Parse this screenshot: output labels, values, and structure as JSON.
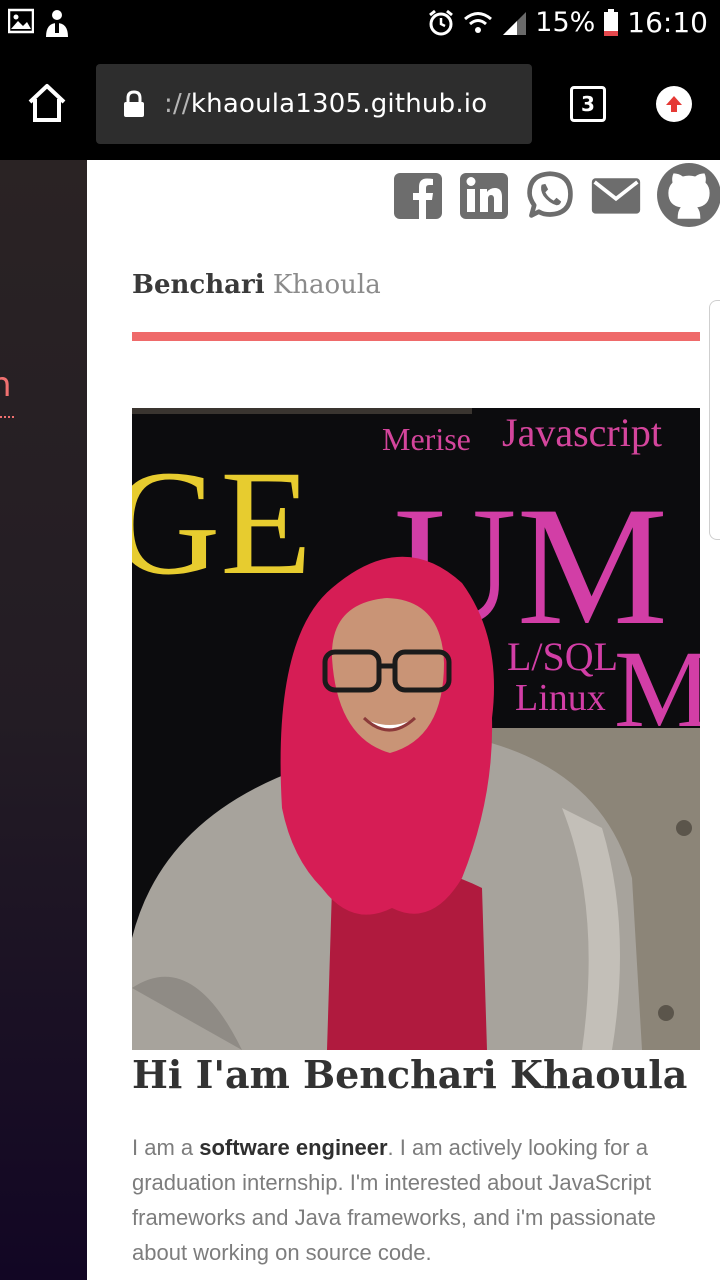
{
  "status_bar": {
    "battery": "15%",
    "time": "16:10"
  },
  "browser": {
    "url_scheme": "://",
    "url_host": "khaoula1305.github.io",
    "tab_count": "3"
  },
  "header": {
    "brand_first": "Benchari",
    "brand_last": "Khaoula",
    "social": [
      "facebook-icon",
      "linkedin-icon",
      "whatsapp-icon",
      "email-icon",
      "github-icon"
    ]
  },
  "side_panel": {
    "glyph": "n"
  },
  "photo": {
    "background_words": [
      "Merise",
      "Javascript",
      "GE",
      "UM",
      "L/SQL",
      "Linux",
      "M"
    ]
  },
  "hero": {
    "title": "Hi I'am Benchari Khaoula",
    "bio_before": "I am a ",
    "bio_strong": "software engineer",
    "bio_after": ". I am actively looking for a graduation internship. I'm interested about JavaScript frameworks and Java frameworks, and i'm passionate about working on source code."
  },
  "colors": {
    "accent": "#ef6a6a",
    "url_field": "#2d2d2d",
    "icon_gray": "#6d6d6d"
  }
}
